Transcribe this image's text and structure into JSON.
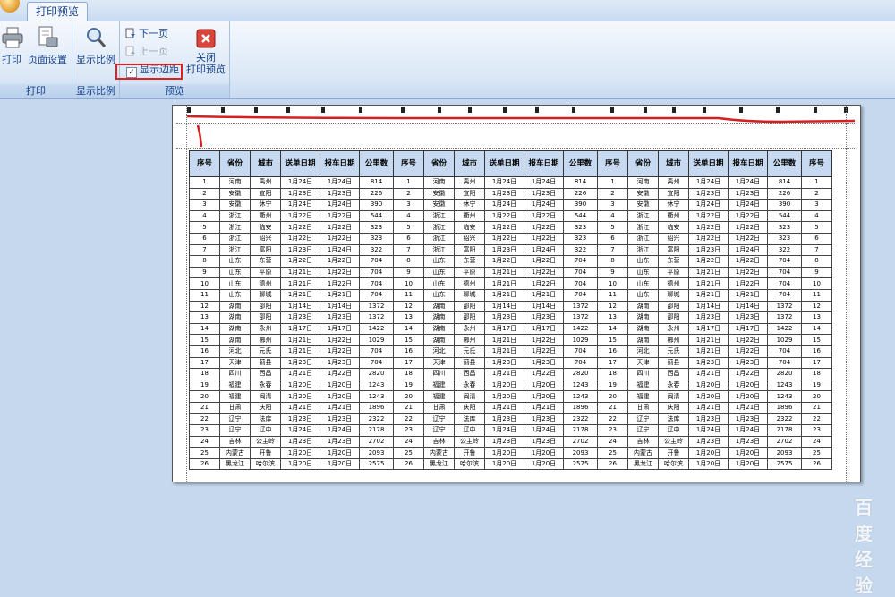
{
  "ribbon": {
    "tab_label": "打印预览",
    "groups": {
      "print": {
        "title": "打印",
        "print_label": "打印",
        "setup_label": "页面设置"
      },
      "zoom": {
        "title": "显示比例",
        "zoom_label": "显示比例"
      },
      "preview": {
        "title": "预览",
        "next_label": "下一页",
        "prev_label": "上一页",
        "margins_label": "显示边距",
        "margins_checked": true,
        "close_label": "关闭",
        "close_label2": "打印预览"
      }
    }
  },
  "colors": {
    "header_fill": "#c6d9f1",
    "highlight": "#e02020"
  },
  "sheet": {
    "headers": [
      "序号",
      "省份",
      "城市",
      "送单日期",
      "报车日期",
      "公里数",
      "序号",
      "省份",
      "城市",
      "送单日期",
      "报车日期",
      "公里数",
      "序号",
      "省份",
      "城市",
      "送单日期",
      "报车日期",
      "公里数",
      "序号"
    ],
    "rows": [
      [
        "1",
        "河南",
        "禹州",
        "1月24日",
        "1月24日",
        "814",
        "1",
        "河南",
        "禹州",
        "1月24日",
        "1月24日",
        "814",
        "1",
        "河南",
        "禹州",
        "1月24日",
        "1月24日",
        "814",
        "1"
      ],
      [
        "2",
        "安徽",
        "宣阳",
        "1月23日",
        "1月23日",
        "226",
        "2",
        "安徽",
        "宣阳",
        "1月23日",
        "1月23日",
        "226",
        "2",
        "安徽",
        "宣阳",
        "1月23日",
        "1月23日",
        "226",
        "2"
      ],
      [
        "3",
        "安徽",
        "休宁",
        "1月24日",
        "1月24日",
        "390",
        "3",
        "安徽",
        "休宁",
        "1月24日",
        "1月24日",
        "390",
        "3",
        "安徽",
        "休宁",
        "1月24日",
        "1月24日",
        "390",
        "3"
      ],
      [
        "4",
        "浙江",
        "衢州",
        "1月22日",
        "1月22日",
        "544",
        "4",
        "浙江",
        "衢州",
        "1月22日",
        "1月22日",
        "544",
        "4",
        "浙江",
        "衢州",
        "1月22日",
        "1月22日",
        "544",
        "4"
      ],
      [
        "5",
        "浙江",
        "临安",
        "1月22日",
        "1月22日",
        "323",
        "5",
        "浙江",
        "临安",
        "1月22日",
        "1月22日",
        "323",
        "5",
        "浙江",
        "临安",
        "1月22日",
        "1月22日",
        "323",
        "5"
      ],
      [
        "6",
        "浙江",
        "绍兴",
        "1月22日",
        "1月22日",
        "323",
        "6",
        "浙江",
        "绍兴",
        "1月22日",
        "1月22日",
        "323",
        "6",
        "浙江",
        "绍兴",
        "1月22日",
        "1月22日",
        "323",
        "6"
      ],
      [
        "7",
        "浙江",
        "富阳",
        "1月23日",
        "1月24日",
        "322",
        "7",
        "浙江",
        "富阳",
        "1月23日",
        "1月24日",
        "322",
        "7",
        "浙江",
        "富阳",
        "1月23日",
        "1月24日",
        "322",
        "7"
      ],
      [
        "8",
        "山东",
        "东营",
        "1月22日",
        "1月22日",
        "704",
        "8",
        "山东",
        "东营",
        "1月22日",
        "1月22日",
        "704",
        "8",
        "山东",
        "东营",
        "1月22日",
        "1月22日",
        "704",
        "8"
      ],
      [
        "9",
        "山东",
        "平原",
        "1月21日",
        "1月22日",
        "704",
        "9",
        "山东",
        "平原",
        "1月21日",
        "1月22日",
        "704",
        "9",
        "山东",
        "平原",
        "1月21日",
        "1月22日",
        "704",
        "9"
      ],
      [
        "10",
        "山东",
        "德州",
        "1月21日",
        "1月22日",
        "704",
        "10",
        "山东",
        "德州",
        "1月21日",
        "1月22日",
        "704",
        "10",
        "山东",
        "德州",
        "1月21日",
        "1月22日",
        "704",
        "10"
      ],
      [
        "11",
        "山东",
        "聊城",
        "1月21日",
        "1月21日",
        "704",
        "11",
        "山东",
        "聊城",
        "1月21日",
        "1月21日",
        "704",
        "11",
        "山东",
        "聊城",
        "1月21日",
        "1月21日",
        "704",
        "11"
      ],
      [
        "12",
        "湖南",
        "邵阳",
        "1月14日",
        "1月14日",
        "1372",
        "12",
        "湖南",
        "邵阳",
        "1月14日",
        "1月14日",
        "1372",
        "12",
        "湖南",
        "邵阳",
        "1月14日",
        "1月14日",
        "1372",
        "12"
      ],
      [
        "13",
        "湖南",
        "邵阳",
        "1月23日",
        "1月23日",
        "1372",
        "13",
        "湖南",
        "邵阳",
        "1月23日",
        "1月23日",
        "1372",
        "13",
        "湖南",
        "邵阳",
        "1月23日",
        "1月23日",
        "1372",
        "13"
      ],
      [
        "14",
        "湖南",
        "永州",
        "1月17日",
        "1月17日",
        "1422",
        "14",
        "湖南",
        "永州",
        "1月17日",
        "1月17日",
        "1422",
        "14",
        "湖南",
        "永州",
        "1月17日",
        "1月17日",
        "1422",
        "14"
      ],
      [
        "15",
        "湖南",
        "郴州",
        "1月21日",
        "1月22日",
        "1029",
        "15",
        "湖南",
        "郴州",
        "1月21日",
        "1月22日",
        "1029",
        "15",
        "湖南",
        "郴州",
        "1月21日",
        "1月22日",
        "1029",
        "15"
      ],
      [
        "16",
        "河北",
        "元氏",
        "1月21日",
        "1月22日",
        "704",
        "16",
        "河北",
        "元氏",
        "1月21日",
        "1月22日",
        "704",
        "16",
        "河北",
        "元氏",
        "1月21日",
        "1月22日",
        "704",
        "16"
      ],
      [
        "17",
        "天津",
        "蓟县",
        "1月23日",
        "1月23日",
        "704",
        "17",
        "天津",
        "蓟县",
        "1月23日",
        "1月23日",
        "704",
        "17",
        "天津",
        "蓟县",
        "1月23日",
        "1月23日",
        "704",
        "17"
      ],
      [
        "18",
        "四川",
        "西昌",
        "1月21日",
        "1月22日",
        "2820",
        "18",
        "四川",
        "西昌",
        "1月21日",
        "1月22日",
        "2820",
        "18",
        "四川",
        "西昌",
        "1月21日",
        "1月22日",
        "2820",
        "18"
      ],
      [
        "19",
        "福建",
        "永春",
        "1月20日",
        "1月20日",
        "1243",
        "19",
        "福建",
        "永春",
        "1月20日",
        "1月20日",
        "1243",
        "19",
        "福建",
        "永春",
        "1月20日",
        "1月20日",
        "1243",
        "19"
      ],
      [
        "20",
        "福建",
        "闽清",
        "1月20日",
        "1月20日",
        "1243",
        "20",
        "福建",
        "闽清",
        "1月20日",
        "1月20日",
        "1243",
        "20",
        "福建",
        "闽清",
        "1月20日",
        "1月20日",
        "1243",
        "20"
      ],
      [
        "21",
        "甘肃",
        "庆阳",
        "1月21日",
        "1月21日",
        "1896",
        "21",
        "甘肃",
        "庆阳",
        "1月21日",
        "1月21日",
        "1896",
        "21",
        "甘肃",
        "庆阳",
        "1月21日",
        "1月21日",
        "1896",
        "21"
      ],
      [
        "22",
        "辽宁",
        "法库",
        "1月23日",
        "1月23日",
        "2322",
        "22",
        "辽宁",
        "法库",
        "1月23日",
        "1月23日",
        "2322",
        "22",
        "辽宁",
        "法库",
        "1月23日",
        "1月23日",
        "2322",
        "22"
      ],
      [
        "23",
        "辽宁",
        "辽中",
        "1月24日",
        "1月24日",
        "2178",
        "23",
        "辽宁",
        "辽中",
        "1月24日",
        "1月24日",
        "2178",
        "23",
        "辽宁",
        "辽中",
        "1月24日",
        "1月24日",
        "2178",
        "23"
      ],
      [
        "24",
        "吉林",
        "公主岭",
        "1月23日",
        "1月23日",
        "2702",
        "24",
        "吉林",
        "公主岭",
        "1月23日",
        "1月23日",
        "2702",
        "24",
        "吉林",
        "公主岭",
        "1月23日",
        "1月23日",
        "2702",
        "24"
      ],
      [
        "25",
        "内蒙古",
        "开鲁",
        "1月20日",
        "1月20日",
        "2093",
        "25",
        "内蒙古",
        "开鲁",
        "1月20日",
        "1月20日",
        "2093",
        "25",
        "内蒙古",
        "开鲁",
        "1月20日",
        "1月20日",
        "2093",
        "25"
      ],
      [
        "26",
        "黑龙江",
        "哈尔滨",
        "1月20日",
        "1月20日",
        "2575",
        "26",
        "黑龙江",
        "哈尔滨",
        "1月20日",
        "1月20日",
        "2575",
        "26",
        "黑龙江",
        "哈尔滨",
        "1月20日",
        "1月20日",
        "2575",
        "26"
      ]
    ]
  },
  "watermark": "百度经验"
}
